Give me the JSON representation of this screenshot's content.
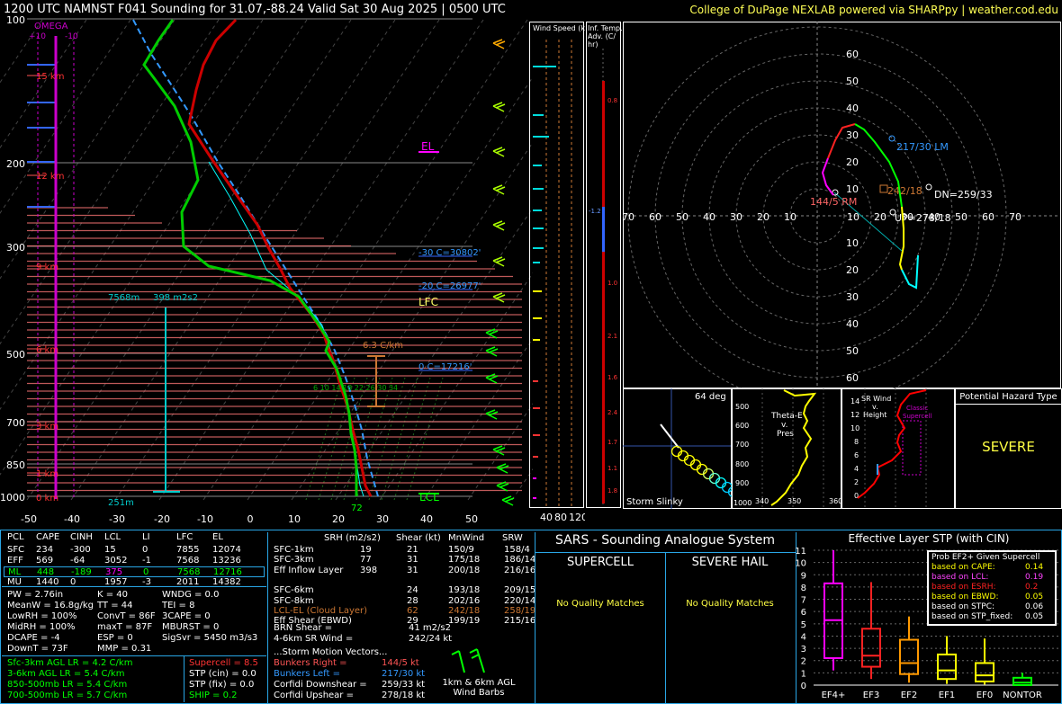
{
  "header": {
    "title": "1200 UTC NAMNST F041 Sounding for 31.07,-88.24 Valid  Sat 30 Aug 2025 | 0500 UTC",
    "credit": "College of DuPage NEXLAB powered via SHARPpy | weather.cod.edu",
    "colors": {
      "title": "#ffffff",
      "credit": "#ffff55"
    }
  },
  "skewt": {
    "pressure_labels": [
      "100",
      "200",
      "300",
      "500",
      "700",
      "850",
      "1000"
    ],
    "temp_labels": [
      "-50",
      "-40",
      "-30",
      "-20",
      "-10",
      "0",
      "10",
      "20",
      "30",
      "40",
      "50"
    ],
    "height_labels": [
      "15 km",
      "12 km",
      "9 km",
      "6 km",
      "3 km",
      "1 km",
      "0 km"
    ],
    "omega_label": "OMEGA",
    "omega_ticks": [
      "+10",
      "-10"
    ],
    "annotations": {
      "el": "EL",
      "lfc": "LFC",
      "lcl": "LCL",
      "m30c": "-30 C=30802'",
      "m20c": "-20 C=26977'",
      "wbz": "0 C=17216'",
      "lapse": "6.3 C/km",
      "top_height": "7568m",
      "top_srh": "398 m2s2",
      "bottom_height": "251m",
      "sfc_td": "72",
      "wetbulb_ticks": "6  10  14  18  22  26 30 34"
    },
    "colors": {
      "temp": "#cc0000",
      "dewp": "#00cc00",
      "vtemp": "#ff3333",
      "parcel": "#3399ff",
      "wetbulb": "#00ffff"
    }
  },
  "wind_speed_panel": {
    "title": "Wind Speed (knots)",
    "ticks": [
      "40",
      "80",
      "120"
    ]
  },
  "inf_temp_panel": {
    "title": "Inf. Temp. Adv. (C/hr)",
    "values": [
      "0.8",
      "-1.2",
      "1.0",
      "2.1",
      "1.6",
      "2.4",
      "1.7",
      "1.1",
      "1.8"
    ]
  },
  "hodograph": {
    "ring_labels": [
      "10",
      "20",
      "30",
      "40",
      "50",
      "60",
      "70"
    ],
    "rm_label": "144/5 RM",
    "lm_label": "217/30 LM",
    "dn_label": "DN=259/33",
    "up_label": "UP=278/18",
    "mean_label": "242/18"
  },
  "storm_slinky": {
    "label": "Storm Slinky",
    "angle": "64 deg"
  },
  "theta_e": {
    "title": "Theta-E v. Pres",
    "ticks": [
      "500",
      "600",
      "700",
      "800",
      "900",
      "1000"
    ],
    "x_ticks": [
      "340",
      "350",
      "360"
    ]
  },
  "sr_wind": {
    "title": "SR Wind v. Height",
    "ticks": [
      "14",
      "12",
      "10",
      "8",
      "6",
      "4",
      "2",
      "0"
    ],
    "supercell_label": "Classic Supercell"
  },
  "hazard": {
    "title": "Potential Hazard Type",
    "value": "SEVERE"
  },
  "parcel_table": {
    "headers": [
      "PCL",
      "CAPE",
      "CINH",
      "LCL",
      "LI",
      "LFC",
      "EL"
    ],
    "rows": [
      [
        "SFC",
        "234",
        "-300",
        "15",
        "0",
        "7855",
        "12074"
      ],
      [
        "EFF",
        "569",
        "-64",
        "3052",
        "-1",
        "7568",
        "13236"
      ],
      [
        "ML",
        "448",
        "-189",
        "375",
        "0",
        "7568",
        "12716"
      ],
      [
        "MU",
        "1440",
        "0",
        "1957",
        "-3",
        "2011",
        "14382"
      ]
    ]
  },
  "thermo_indices": {
    "col1": [
      "PW = 2.76in",
      "MeanW = 16.8g/kg",
      "LowRH = 100%",
      "MidRH = 100%",
      "DCAPE = -4",
      "DownT = 73F"
    ],
    "col2": [
      "K = 40",
      "TT = 44",
      "ConvT = 86F",
      "maxT = 87F",
      "ESP = 0",
      "MMP = 0.31"
    ],
    "col3": [
      "WNDG = 0.0",
      "TEI = 8",
      "3CAPE = 0",
      "MBURST = 0",
      "",
      "SigSvr = 5450 m3/s3"
    ]
  },
  "lapse_rates": [
    "Sfc-3km AGL LR = 4.2 C/km",
    "3-6km AGL LR = 5.4 C/km",
    "850-500mb LR = 5.4 C/km",
    "700-500mb LR = 5.7 C/km"
  ],
  "composite": {
    "supercell": "Supercell = 8.5",
    "stp_cin": "STP (cin) = 0.0",
    "stp_fix": "STP (fix) = 0.0",
    "ship": "SHIP = 0.2"
  },
  "kinematics": {
    "headers": [
      "SRH (m2/s2)",
      "Shear (kt)",
      "MnWind",
      "SRW"
    ],
    "rows": [
      [
        "SFC-1km",
        "19",
        "21",
        "150/9",
        "158/4"
      ],
      [
        "SFC-3km",
        "77",
        "31",
        "175/18",
        "186/14"
      ],
      [
        "Eff Inflow Layer",
        "398",
        "31",
        "200/18",
        "216/16"
      ],
      [
        "",
        "",
        "",
        "",
        ""
      ],
      [
        "SFC-6km",
        "24",
        "193/18",
        "209/15",
        ""
      ],
      [
        "SFC-8km",
        "28",
        "202/16",
        "220/14",
        ""
      ],
      [
        "LCL-EL (Cloud Layer)",
        "62",
        "242/18",
        "258/19",
        ""
      ],
      [
        "Eff Shear (EBWD)",
        "29",
        "199/19",
        "215/16",
        ""
      ]
    ],
    "brn_label": "BRN Shear =",
    "brn_value": "41 m2/s2",
    "srw46_label": "4-6km SR Wind =",
    "srw46_value": "242/24 kt",
    "storm_motion_title": "...Storm Motion Vectors...",
    "bunkers_right_label": "Bunkers Right =",
    "bunkers_right_value": "144/5 kt",
    "bunkers_left_label": "Bunkers Left =",
    "bunkers_left_value": "217/30 kt",
    "corfidi_down_label": "Corfidi Downshear =",
    "corfidi_down_value": "259/33 kt",
    "corfidi_up_label": "Corfidi Upshear =",
    "corfidi_up_value": "278/18 kt",
    "barbs_label": "1km & 6km AGL Wind Barbs"
  },
  "sars": {
    "title": "SARS - Sounding Analogue System",
    "supercell_title": "SUPERCELL",
    "supercell_msg": "No Quality Matches",
    "hail_title": "SEVERE HAIL",
    "hail_msg": "No Quality Matches"
  },
  "stp_chart": {
    "title": "Effective Layer STP (with CIN)",
    "prob_title": "Prob EF2+ Given Supercell",
    "probs": [
      {
        "label": "based on CAPE:",
        "value": "0.14",
        "color": "#ffff00"
      },
      {
        "label": "based on LCL:",
        "value": "0.19",
        "color": "#ff44ff"
      },
      {
        "label": "based on ESRH:",
        "value": "0.2",
        "color": "#ff2222"
      },
      {
        "label": "based on EBWD:",
        "value": "0.05",
        "color": "#ffff00"
      },
      {
        "label": "based on STPC:",
        "value": "0.06",
        "color": "#ffffff"
      },
      {
        "label": "based on STP_fixed:",
        "value": "0.05",
        "color": "#ffffff"
      }
    ]
  },
  "chart_data": {
    "type": "bar",
    "categories": [
      "EF4+",
      "EF3",
      "EF2",
      "EF1",
      "EF0",
      "NONTOR"
    ],
    "y_ticks": [
      "0",
      "1",
      "2",
      "3",
      "4",
      "5",
      "6",
      "7",
      "8",
      "9",
      "10",
      "11"
    ],
    "ylim": [
      0,
      11
    ],
    "boxes": [
      {
        "name": "EF4+",
        "whisker_low": 1.2,
        "q1": 2.2,
        "median": 5.3,
        "q3": 8.3,
        "whisker_high": 11.0,
        "color": "#ff00ff"
      },
      {
        "name": "EF3",
        "whisker_low": 0.5,
        "q1": 1.5,
        "median": 2.4,
        "q3": 4.6,
        "whisker_high": 8.4,
        "color": "#ff2222"
      },
      {
        "name": "EF2",
        "whisker_low": 0.2,
        "q1": 0.9,
        "median": 1.8,
        "q3": 3.7,
        "whisker_high": 5.6,
        "color": "#ff9900"
      },
      {
        "name": "EF1",
        "whisker_low": 0.1,
        "q1": 0.5,
        "median": 1.2,
        "q3": 2.5,
        "whisker_high": 4.0,
        "color": "#ffff00"
      },
      {
        "name": "EF0",
        "whisker_low": 0.05,
        "q1": 0.3,
        "median": 0.8,
        "q3": 1.8,
        "whisker_high": 3.8,
        "color": "#ffff00"
      },
      {
        "name": "NONTOR",
        "whisker_low": 0.0,
        "q1": 0.0,
        "median": 0.2,
        "q3": 0.6,
        "whisker_high": 1.0,
        "color": "#00ff00"
      }
    ],
    "xlabel": "",
    "ylabel": ""
  }
}
